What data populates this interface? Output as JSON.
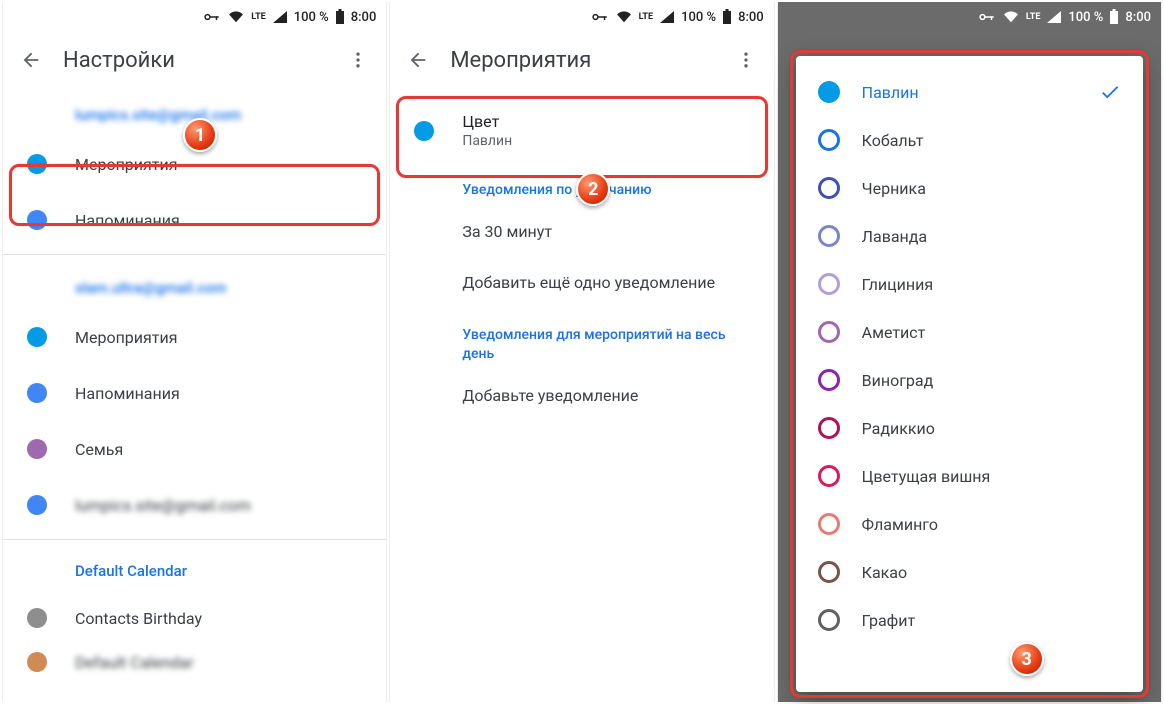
{
  "status": {
    "time": "8:00",
    "battery": "100 %",
    "lte": "LTE"
  },
  "screen1": {
    "title": "Настройки",
    "account1_email": "lumpics.site@gmail.com",
    "items1": [
      {
        "label": "Мероприятия",
        "color": "#039be5"
      },
      {
        "label": "Напоминания",
        "color": "#4285f4"
      }
    ],
    "account2_email": "slam.ultra@gmail.com",
    "items2": [
      {
        "label": "Мероприятия",
        "color": "#039be5"
      },
      {
        "label": "Напоминания",
        "color": "#4285f4"
      },
      {
        "label": "Семья",
        "color": "#9e69af"
      },
      {
        "label": "lumpics.site@gmail.com",
        "color": "#4285f4",
        "blur": true
      }
    ],
    "default_calendar_label": "Default Calendar",
    "items3": [
      {
        "label": "Contacts Birthday",
        "color": "#8e8e8e"
      },
      {
        "label": "Default Calendar",
        "color": "#d08b55"
      }
    ]
  },
  "screen2": {
    "title": "Мероприятия",
    "color_row": {
      "title": "Цвет",
      "sub": "Павлин",
      "color": "#039be5"
    },
    "section_default_notif": "Уведомления по умолчанию",
    "notif_30": "За 30 минут",
    "add_notif": "Добавить ещё одно уведомление",
    "section_allday_notif": "Уведомления для мероприятий на весь день",
    "add_notif2": "Добавьте уведомление"
  },
  "screen3": {
    "colors": [
      {
        "label": "Павлин",
        "hex": "#039be5",
        "selected": true
      },
      {
        "label": "Кобальт",
        "hex": "#1a73e8"
      },
      {
        "label": "Черника",
        "hex": "#3f51b5"
      },
      {
        "label": "Лаванда",
        "hex": "#7986cb"
      },
      {
        "label": "Глициния",
        "hex": "#b39ddb"
      },
      {
        "label": "Аметист",
        "hex": "#9e69af"
      },
      {
        "label": "Виноград",
        "hex": "#8e24aa"
      },
      {
        "label": "Радиккио",
        "hex": "#ad1357"
      },
      {
        "label": "Цветущая вишня",
        "hex": "#d81b60"
      },
      {
        "label": "Фламинго",
        "hex": "#e67c73"
      },
      {
        "label": "Какао",
        "hex": "#795548"
      },
      {
        "label": "Графит",
        "hex": "#616161"
      }
    ]
  },
  "badges": {
    "b1": "1",
    "b2": "2",
    "b3": "3"
  }
}
